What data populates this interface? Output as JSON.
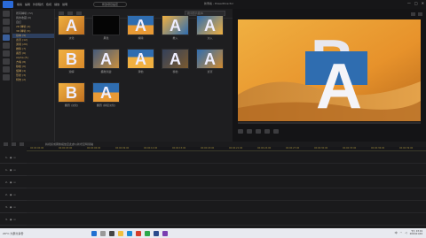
{
  "app": {
    "title_button": "修改項目設定",
    "project_name": "新專案 - PowerDirector"
  },
  "menus": [
    "檔案",
    "編輯",
    "外掛程式",
    "檢視",
    "播放",
    "說明"
  ],
  "library": {
    "search_placeholder": "搜尋影片範本",
    "tree": [
      "所有轉場 (72)",
      "我的收藏 (0)",
      "自訂",
      "2D 轉場 (4)",
      "3D 轉場 (5)",
      "基本 (9)",
      "遮罩 (12)",
      "通用 (20)",
      "推移 (7)",
      "長形 (6)",
      "Alpha (5)",
      "方塊 (8)",
      "移動 (6)",
      "旋轉 (4)",
      "形狀 (3)",
      "特效 (2)"
    ],
    "thumbs": [
      {
        "caption": "淡化"
      },
      {
        "caption": "黑色"
      },
      {
        "caption": "擦除"
      },
      {
        "caption": "推入"
      },
      {
        "caption": "淡入"
      },
      {
        "caption": "溶解"
      },
      {
        "caption": "擴散漸變"
      },
      {
        "caption": "滑動"
      },
      {
        "caption": "移動"
      },
      {
        "caption": "遮罩"
      },
      {
        "caption": "翻頁 (淡化)"
      },
      {
        "caption": "翻頁 (拼接淡化)"
      }
    ]
  },
  "timeline": {
    "note": "將視訊或圖像拖放至此處以新增至時間軸",
    "ticks": [
      "00:00:00:00",
      "00:00:03:00",
      "00:00:06:00",
      "00:00:09:00",
      "00:00:12:00",
      "00:00:15:00",
      "00:00:18:00",
      "00:00:21:00",
      "00:00:24:00",
      "00:00:27:00",
      "00:00:30:00",
      "00:00:33:00",
      "00:00:36:00",
      "00:00:39:00"
    ],
    "tracks": [
      "1.",
      "1.",
      "2.",
      "2.",
      "3.",
      "3."
    ]
  },
  "taskbar": {
    "weather": "20°C 大部分多雲",
    "lang": "中",
    "time": "下午 03:19",
    "date": "2024/11/04"
  },
  "colors": {
    "accent": "#2a6ad8",
    "highlight": "#c9a25a"
  }
}
